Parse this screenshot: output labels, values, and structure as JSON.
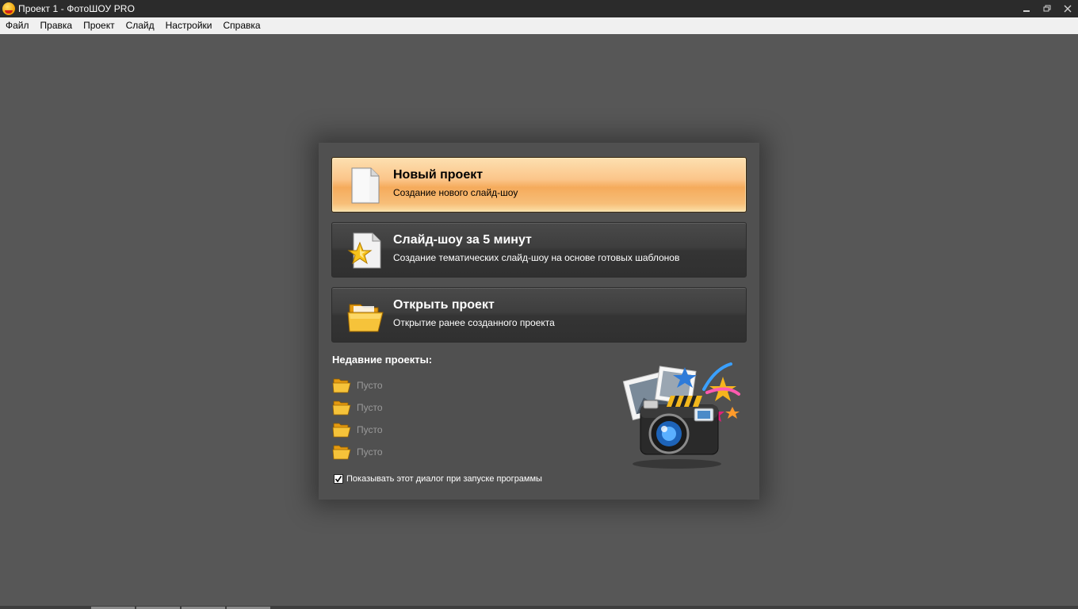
{
  "window": {
    "title": "Проект 1 - ФотоШОУ PRO"
  },
  "menu": {
    "items": [
      "Файл",
      "Правка",
      "Проект",
      "Слайд",
      "Настройки",
      "Справка"
    ]
  },
  "dialog": {
    "actions": [
      {
        "title": "Новый проект",
        "subtitle": "Создание нового слайд-шоу",
        "icon": "new-document-icon"
      },
      {
        "title": "Слайд-шоу за 5 минут",
        "subtitle": "Создание тематических слайд-шоу на основе готовых шаблонов",
        "icon": "star-document-icon"
      },
      {
        "title": "Открыть проект",
        "subtitle": "Открытие ранее созданного проекта",
        "icon": "open-folder-icon"
      }
    ],
    "recent": {
      "heading": "Недавние проекты:",
      "items": [
        "Пусто",
        "Пусто",
        "Пусто",
        "Пусто"
      ]
    },
    "show_on_startup": {
      "label": "Показывать этот диалог при запуске программы",
      "checked": true
    }
  },
  "colors": {
    "background": "#575757",
    "titlebar": "#2b2b2b",
    "dialog": "#505050",
    "active_button": "#f5ab5c"
  }
}
